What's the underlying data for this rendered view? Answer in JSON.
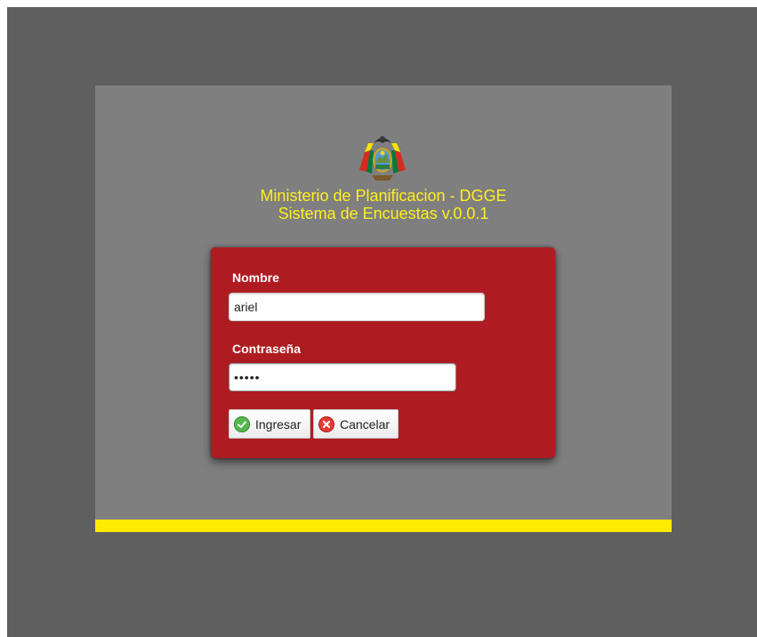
{
  "header": {
    "line1": "Ministerio de Planificacion - DGGE",
    "line2": "Sistema de Encuestas v.0.0.1"
  },
  "login": {
    "nombre_label": "Nombre",
    "nombre_value": "ariel",
    "password_label": "Contraseña",
    "password_value": "•••••",
    "submit_label": "Ingresar",
    "cancel_label": "Cancelar"
  },
  "icons": {
    "emblem": "bolivia-coat-of-arms",
    "submit": "check-circle-icon",
    "cancel": "x-circle-icon"
  },
  "colors": {
    "background": "#5f5f5f",
    "panel": "#7f7f7f",
    "accent_yellow": "#ffec00",
    "title_text": "#ffef1f",
    "login_box": "#ae1c22"
  }
}
